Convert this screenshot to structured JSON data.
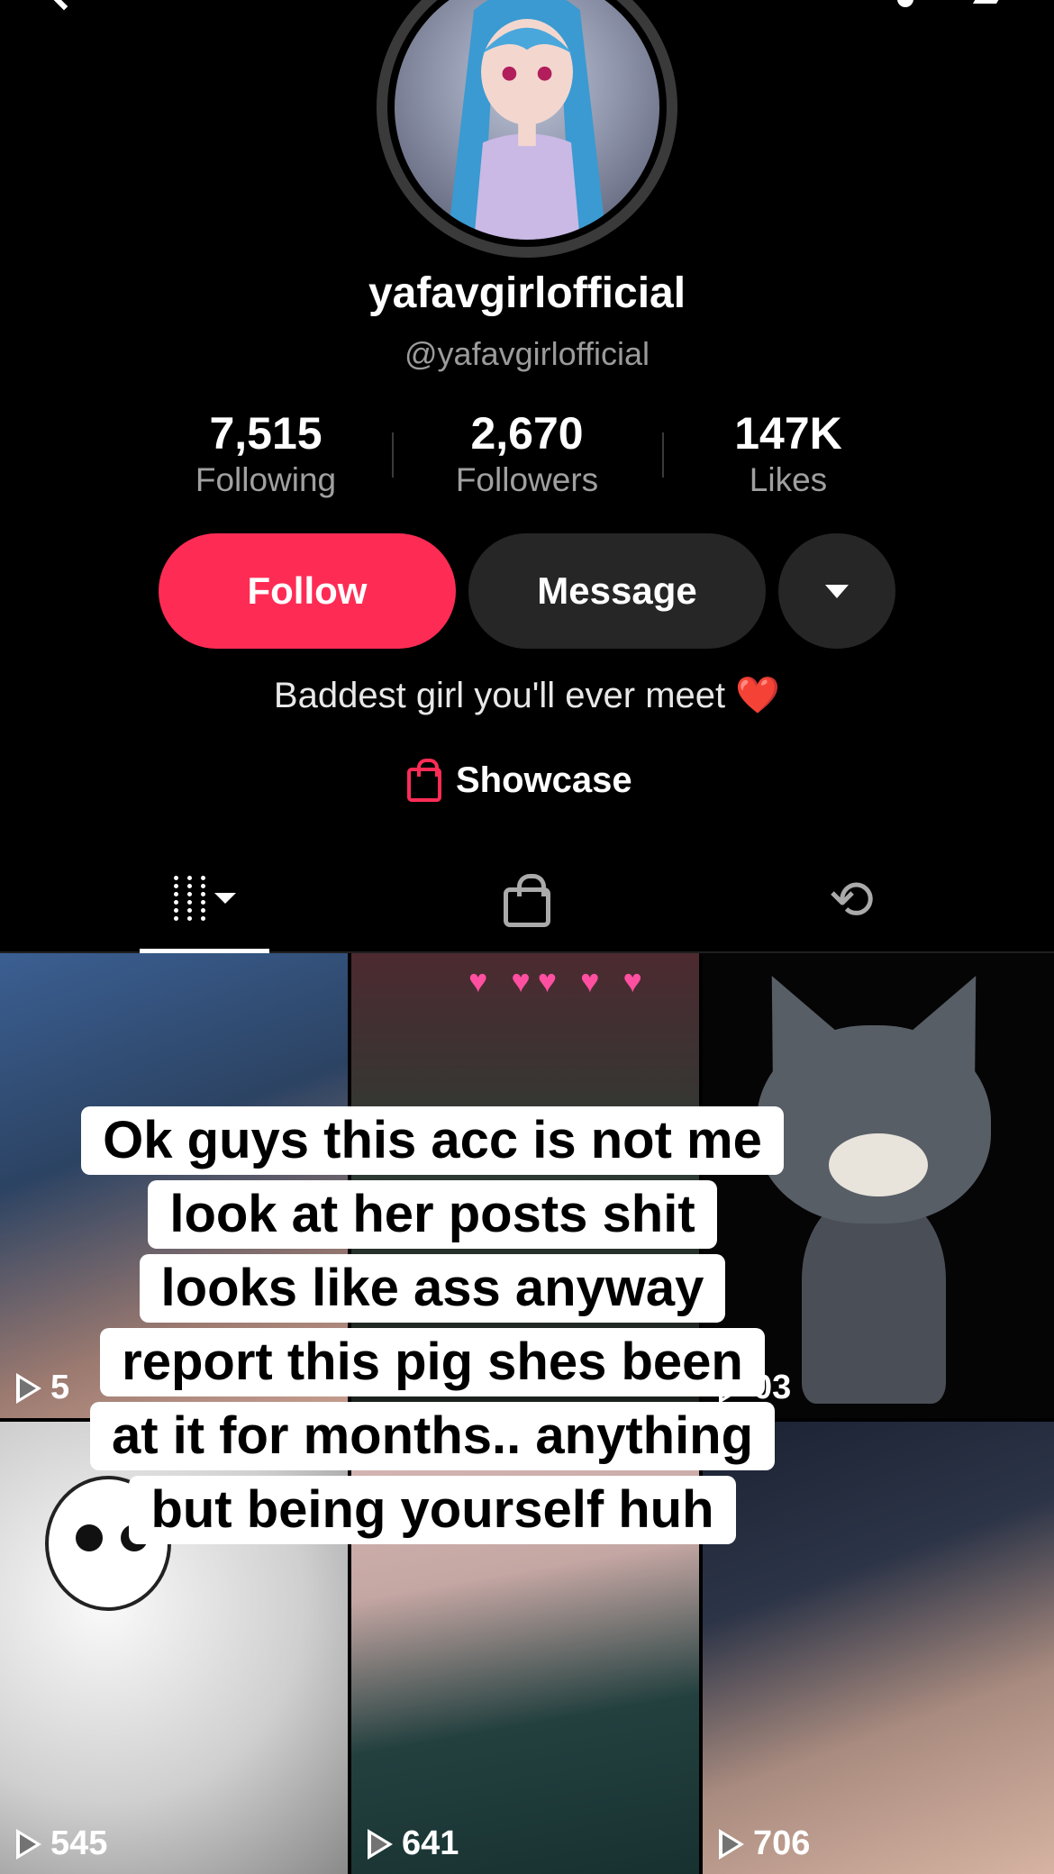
{
  "profile": {
    "display_name": "yafavgirlofficial",
    "handle": "@yafavgirlofficial",
    "bio_text": "Baddest girl you'll ever meet",
    "bio_emoji": "❤️"
  },
  "stats": [
    {
      "value": "7,515",
      "label": "Following"
    },
    {
      "value": "2,670",
      "label": "Followers"
    },
    {
      "value": "147K",
      "label": "Likes"
    }
  ],
  "actions": {
    "follow_label": "Follow",
    "message_label": "Message"
  },
  "showcase": {
    "label": "Showcase"
  },
  "tabs": [
    "videos-grid-icon",
    "shop-bag-icon",
    "repost-icon"
  ],
  "videos": [
    {
      "play_count": ""
    },
    {
      "play_count": ""
    },
    {
      "play_count": ""
    },
    {
      "play_count": "545"
    },
    {
      "play_count": "641"
    },
    {
      "play_count": "706"
    }
  ],
  "partial_counts": {
    "first": "5",
    "third": "03"
  },
  "caption_overlay": [
    "Ok guys this acc is not me",
    "look at her posts shit",
    "looks like ass anyway",
    "report this pig shes been",
    "at it for months.. anything",
    "but being yourself huh"
  ],
  "colors": {
    "accent": "#fe2c55",
    "background": "#000000",
    "secondary_button": "#262626"
  }
}
